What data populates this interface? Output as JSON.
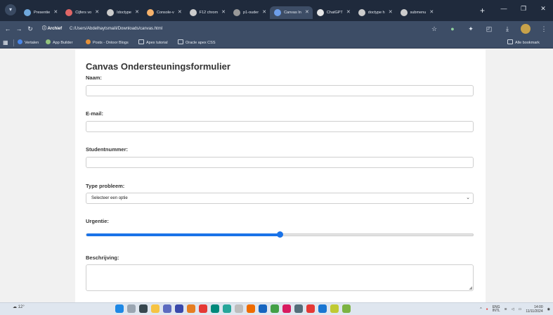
{
  "browser": {
    "tabs": [
      {
        "label": "Presentie",
        "color": "#6fa8dc",
        "active": false
      },
      {
        "label": "Cijfers vo",
        "color": "#e06666",
        "active": false
      },
      {
        "label": "Idoctype",
        "color": "#cccccc",
        "active": false
      },
      {
        "label": "Console-v",
        "color": "#f6b26b",
        "active": false
      },
      {
        "label": "F12 chrom",
        "color": "#cccccc",
        "active": false
      },
      {
        "label": "p1-ouder",
        "color": "#999999",
        "active": false
      },
      {
        "label": "Canvas In",
        "color": "#6d9eeb",
        "active": true
      },
      {
        "label": "ChatGPT",
        "color": "#e6e6e6",
        "active": false
      },
      {
        "label": "doctype h",
        "color": "#cccccc",
        "active": false
      },
      {
        "label": "submenu",
        "color": "#cccccc",
        "active": false
      }
    ],
    "site_info_label": "Archief",
    "url": "C:/Users/Abdelhaytsmaili/Downloads/canvas.html",
    "bookmarks": [
      {
        "label": "Vertalen",
        "icon": "translate-icon"
      },
      {
        "label": "App Builder",
        "icon": "app-builder-icon"
      },
      {
        "label": "Posts - Ontoor Blogs",
        "icon": "blog-icon"
      },
      {
        "label": "Apex tutorial",
        "icon": "folder-icon"
      },
      {
        "label": "Oracle apex CSS",
        "icon": "folder-icon"
      }
    ],
    "all_bookmarks_label": "Alle bookmark"
  },
  "form": {
    "title": "Canvas Ondersteuningsformulier",
    "name_label": "Naam:",
    "email_label": "E-mail:",
    "student_label": "Studentnummer:",
    "problem_label": "Type probleem:",
    "problem_selected": "Selecteer een optie",
    "urgency_label": "Urgentie:",
    "urgency_value_fraction": 0.5,
    "description_label": "Beschrijving:",
    "accent_color": "#1a73e8"
  },
  "taskbar": {
    "weather": "12°",
    "lang_top": "ENG",
    "lang_bottom": "INTL",
    "time": "14:00",
    "date": "11/11/2024"
  }
}
